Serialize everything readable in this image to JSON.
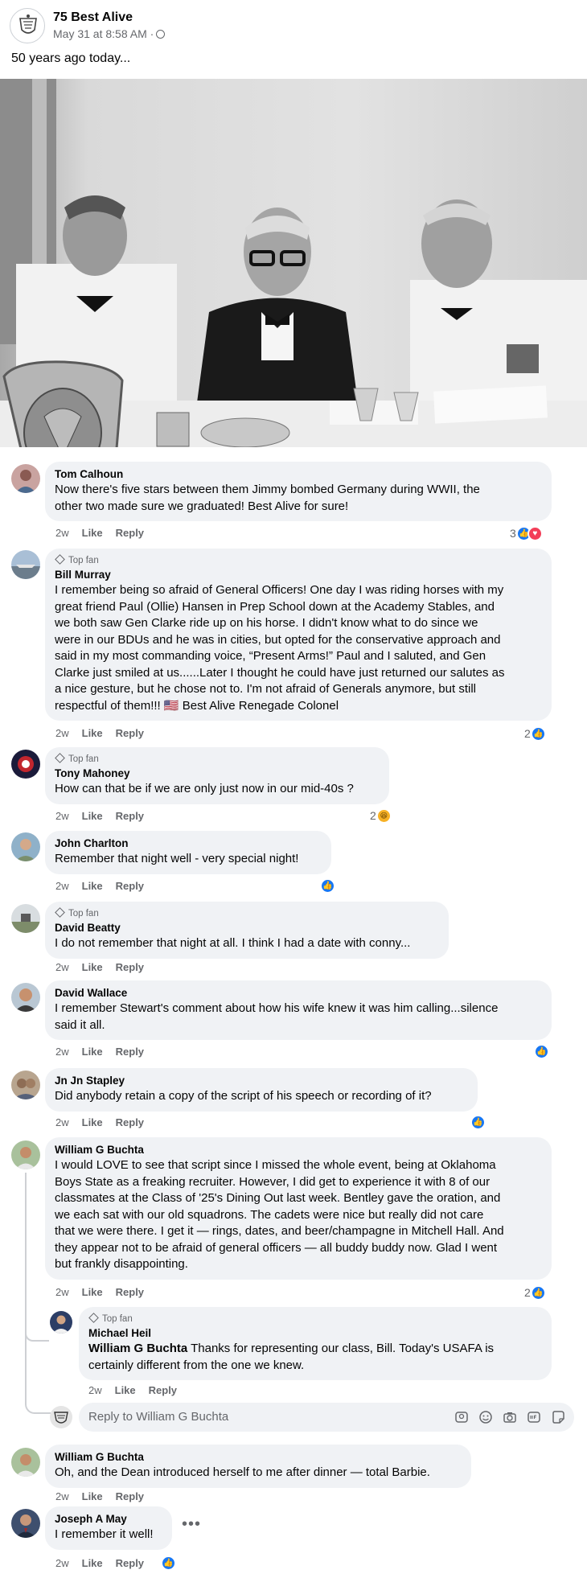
{
  "post": {
    "page_name": "75 Best Alive",
    "date": "May 31 at 8:58 AM ·",
    "text": "50 years ago today...",
    "photo_icon": "group-photo-image"
  },
  "comments": [
    {
      "author": "Tom Calhoun",
      "lines": [
        "Now there's five stars between them Jimmy bombed Germany during WWII, the",
        "other two made sure we graduated! Best Alive for sure!"
      ],
      "ago": "2w",
      "like": "Like",
      "reply": "Reply",
      "reaction_count": "3"
    },
    {
      "badge": "Top fan",
      "author": "Bill Murray",
      "lines": [
        "I remember being so afraid of General Officers! One day I was riding horses with my",
        "great friend Paul (Ollie) Hansen in Prep School down at the Academy Stables, and",
        "we both saw Gen Clarke ride up on his horse. I didn't know what to do since we",
        "were in our BDUs and he was in cities, but opted for the conservative approach and",
        "said in my most commanding voice, “Present Arms!” Paul and I saluted, and Gen",
        "Clarke just smiled at us......Later I thought he could have just returned our salutes as",
        "a nice gesture, but he chose not to. I'm not afraid of Generals anymore, but still",
        "respectful of them!!! 🇺🇸 Best Alive Renegade Colonel"
      ],
      "ago": "2w",
      "like": "Like",
      "reply": "Reply",
      "reaction_count": "2"
    },
    {
      "badge": "Top fan",
      "author": "Tony Mahoney",
      "lines": [
        "How can that be if we are only just now in our mid-40s ?"
      ],
      "ago": "2w",
      "like": "Like",
      "reply": "Reply",
      "reaction_count": "2"
    },
    {
      "author": "John Charlton",
      "lines": [
        "Remember that night well - very special night!"
      ],
      "ago": "2w",
      "like": "Like",
      "reply": "Reply"
    },
    {
      "badge": "Top fan",
      "author": "David Beatty",
      "lines": [
        "I do not remember that night at all. I think I had a date with conny..."
      ],
      "ago": "2w",
      "like": "Like",
      "reply": "Reply"
    },
    {
      "author": "David Wallace",
      "lines": [
        "I remember Stewart's comment about how his wife knew it was him calling...silence",
        "said it all."
      ],
      "ago": "2w",
      "like": "Like",
      "reply": "Reply"
    },
    {
      "author": "Jn Jn Stapley",
      "lines": [
        "Did anybody retain a copy of the script of his speech or recording of it?"
      ],
      "ago": "2w",
      "like": "Like",
      "reply": "Reply"
    },
    {
      "author": "William G Buchta",
      "lines": [
        "I would LOVE to see that script since I missed the whole event, being at Oklahoma",
        "Boys State as a freaking recruiter. However, I did get to experience it with 8 of our",
        "classmates at the Class of '25's Dining Out last week. Bentley gave the oration, and",
        "we each sat with our old squadrons. The cadets were nice but really did not care",
        "that we were there. I get it — rings, dates, and beer/champagne in Mitchell Hall. And",
        "they appear not to be afraid of general officers — all buddy buddy now. Glad I went",
        "but frankly disappointing."
      ],
      "ago": "2w",
      "like": "Like",
      "reply": "Reply",
      "reaction_count": "2"
    },
    {
      "badge": "Top fan",
      "author": "Michael Heil",
      "mention": "William G Buchta",
      "first_line_rest": " Thanks for representing our class, Bill. Today's USAFA is",
      "lines": [
        "certainly different from the one we knew."
      ],
      "ago": "2w",
      "like": "Like",
      "reply": "Reply"
    },
    {
      "author": "William G Buchta",
      "lines": [
        "Oh, and the Dean introduced herself to me after dinner — total Barbie."
      ],
      "ago": "2w",
      "like": "Like",
      "reply": "Reply"
    },
    {
      "author": "Joseph A May",
      "lines": [
        "I remember it well!"
      ],
      "ago": "2w",
      "like": "Like",
      "reply": "Reply"
    }
  ],
  "reply_box": {
    "placeholder": "Reply to William G Buchta",
    "tools": [
      "avatar-sticker-icon",
      "emoji-icon",
      "camera-icon",
      "gif-icon",
      "sticker-icon"
    ]
  },
  "colors": {
    "bubble": "#f0f2f5",
    "meta": "#65676b",
    "like_blue": "#1877f2",
    "love_red": "#f33e58",
    "haha_yellow": "#f7b125"
  }
}
